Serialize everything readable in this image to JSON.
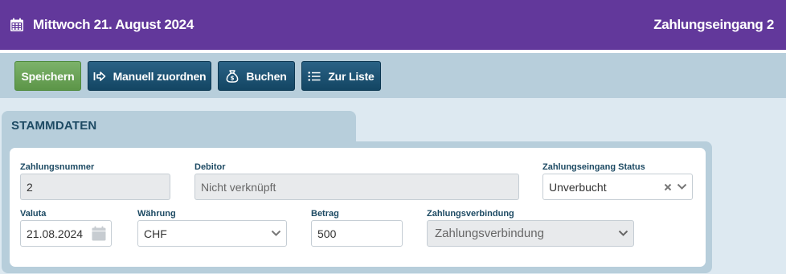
{
  "header": {
    "date": "Mittwoch 21. August 2024",
    "title": "Zahlungseingang 2",
    "icon": "calendar-icon",
    "background": "#62389b"
  },
  "toolbar": {
    "save_label": "Speichern",
    "assign_label": "Manuell zuordnen",
    "book_label": "Buchen",
    "list_label": "Zur Liste",
    "assign_icon": "sign-in-icon",
    "book_icon": "money-bag-icon",
    "list_icon": "list-icon",
    "colors": {
      "save": "#6aa357",
      "primary": "#1b5274"
    }
  },
  "section": {
    "title": "STAMMDATEN"
  },
  "form": {
    "zahlungsnummer": {
      "label": "Zahlungsnummer",
      "value": "2"
    },
    "debitor": {
      "label": "Debitor",
      "value": "Nicht verknüpft"
    },
    "status": {
      "label": "Zahlungseingang Status",
      "value": "Unverbucht"
    },
    "valuta": {
      "label": "Valuta",
      "value": "21.08.2024"
    },
    "waehrung": {
      "label": "Währung",
      "value": "CHF"
    },
    "betrag": {
      "label": "Betrag",
      "value": "500"
    },
    "zahlungsverbindung": {
      "label": "Zahlungsverbindung",
      "placeholder": "Zahlungsverbindung"
    }
  }
}
